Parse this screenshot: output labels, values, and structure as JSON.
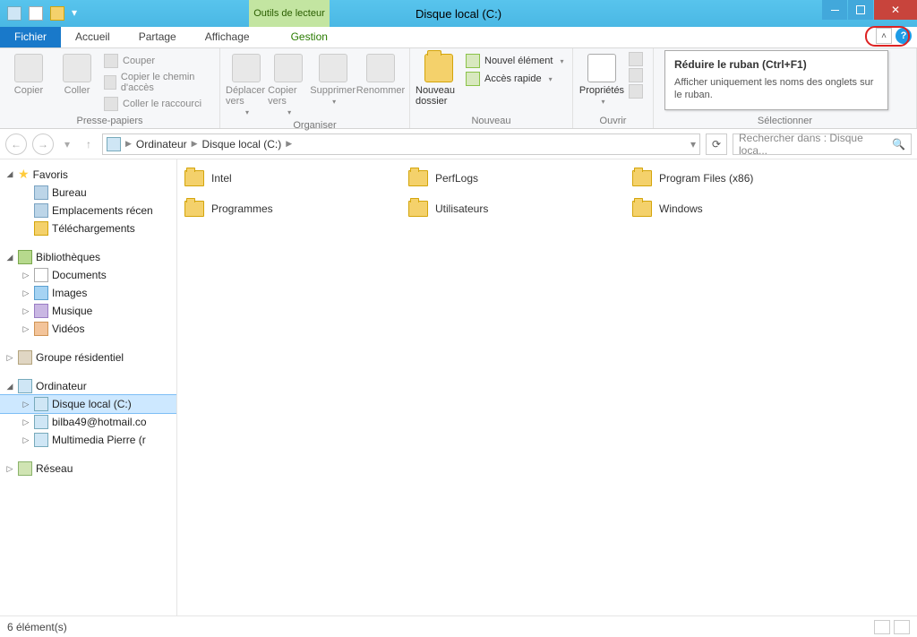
{
  "window": {
    "title": "Disque local (C:)",
    "contextual_tab": "Outils de lecteur"
  },
  "tabs": {
    "file": "Fichier",
    "home": "Accueil",
    "share": "Partage",
    "view": "Affichage",
    "manage": "Gestion"
  },
  "ribbon": {
    "clipboard": {
      "copy": "Copier",
      "paste": "Coller",
      "cut": "Couper",
      "copy_path": "Copier le chemin d'accès",
      "paste_shortcut": "Coller le raccourci",
      "label": "Presse-papiers"
    },
    "organize": {
      "move_to": "Déplacer vers",
      "copy_to": "Copier vers",
      "delete": "Supprimer",
      "rename": "Renommer",
      "label": "Organiser"
    },
    "new": {
      "new_folder": "Nouveau dossier",
      "new_item": "Nouvel élément",
      "easy_access": "Accès rapide",
      "label": "Nouveau"
    },
    "open": {
      "properties": "Propriétés",
      "label": "Ouvrir"
    },
    "select": {
      "label": "Sélectionner"
    }
  },
  "tooltip": {
    "title": "Réduire le ruban (Ctrl+F1)",
    "body": "Afficher uniquement les noms des onglets sur le ruban."
  },
  "nav": {
    "breadcrumb": [
      "Ordinateur",
      "Disque local (C:)"
    ],
    "search_placeholder": "Rechercher dans : Disque loca..."
  },
  "tree": {
    "favorites": {
      "label": "Favoris",
      "items": [
        "Bureau",
        "Emplacements récen",
        "Téléchargements"
      ]
    },
    "libraries": {
      "label": "Bibliothèques",
      "items": [
        "Documents",
        "Images",
        "Musique",
        "Vidéos"
      ]
    },
    "homegroup": "Groupe résidentiel",
    "computer": {
      "label": "Ordinateur",
      "items": [
        "Disque local (C:)",
        "bilba49@hotmail.co",
        "Multimedia Pierre (r"
      ]
    },
    "network": "Réseau"
  },
  "folders": {
    "col1": [
      "Intel",
      "Programmes"
    ],
    "col2": [
      "PerfLogs",
      "Utilisateurs"
    ],
    "col3": [
      "Program Files (x86)",
      "Windows"
    ]
  },
  "status": {
    "count": "6 élément(s)"
  }
}
